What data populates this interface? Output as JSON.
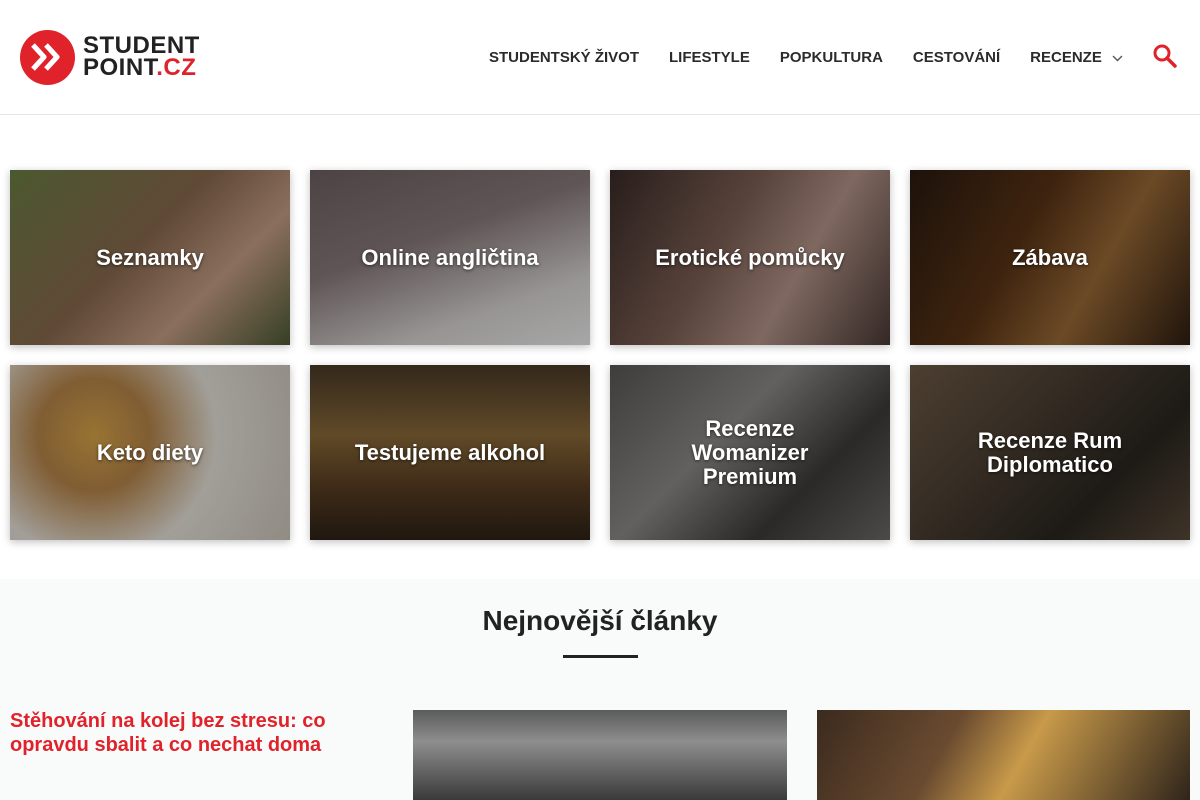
{
  "brand": {
    "line1": "STUDENT",
    "line2_main": "POINT",
    "line2_accent": ".CZ",
    "accent_color": "#e0232b"
  },
  "nav": {
    "items": [
      {
        "label": "STUDENTSKÝ ŽIVOT"
      },
      {
        "label": "LIFESTYLE"
      },
      {
        "label": "POPKULTURA"
      },
      {
        "label": "CESTOVÁNÍ"
      },
      {
        "label": "RECENZE",
        "has_submenu": true
      }
    ],
    "search_icon": "search-icon"
  },
  "categories": [
    {
      "label": "Seznamky"
    },
    {
      "label": "Online angličtina"
    },
    {
      "label": "Erotické pomůcky"
    },
    {
      "label": "Zábava"
    },
    {
      "label": "Keto diety"
    },
    {
      "label": "Testujeme alkohol"
    },
    {
      "label": "Recenze Womanizer Premium"
    },
    {
      "label": "Recenze Rum Diplomatico"
    }
  ],
  "latest": {
    "heading": "Nejnovější články",
    "articles": [
      {
        "title": "Stěhování na kolej bez stresu: co opravdu sbalit a co nechat doma"
      }
    ]
  }
}
